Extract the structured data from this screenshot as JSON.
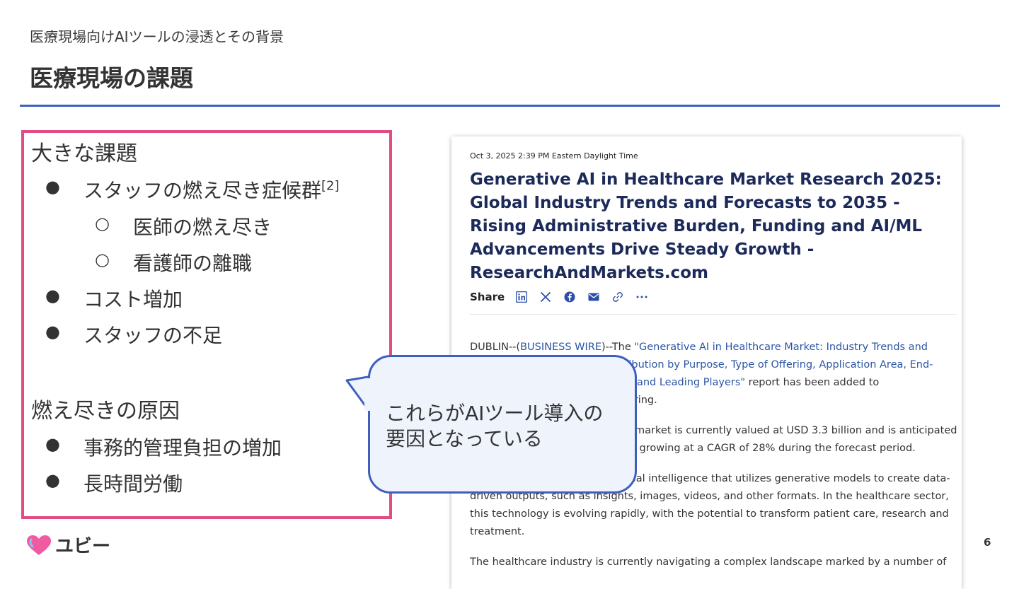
{
  "header": {
    "subtitle": "医療現場向けAIツールの浸透とその背景",
    "title": "医療現場の課題"
  },
  "left": {
    "section1_heading": "大きな課題",
    "bullets1": [
      {
        "label": "スタッフの燃え尽き症候群",
        "ref": "[2]"
      },
      {
        "label": "コスト増加"
      },
      {
        "label": "スタッフの不足"
      }
    ],
    "sub_bullets": [
      "医師の燃え尽き",
      "看護師の離職"
    ],
    "section2_heading": "燃え尽きの原因",
    "bullets2": [
      "事務的管理負担の増加",
      "長時間労働"
    ]
  },
  "article": {
    "date": "Oct 3, 2025 2:39 PM Eastern Daylight Time",
    "title": "Generative AI in Healthcare Market Research 2025: Global Industry Trends and Forecasts to 2035 - Rising Administrative Burden, Funding and AI/ML Advancements Drive Steady Growth - ResearchAndMarkets.com",
    "share_label": "Share",
    "share_icons": [
      "linkedin-icon",
      "x-icon",
      "facebook-icon",
      "email-icon",
      "link-icon",
      "more-icon"
    ],
    "p1_prefix": "DUBLIN--(",
    "p1_bw": "BUSINESS WIRE",
    "p1_mid": ")--The ",
    "p1_link": "\"Generative AI in Healthcare Market: Industry Trends and Global Forecasts to 2035: Distribution by Purpose, Type of Offering, Application Area, End-User, Key Geographical Regions and Leading Players\"",
    "p1_rest": " report has been added to ResearchAndMarkets.com's offering.",
    "p2": "The generative AI in healthcare market is currently valued at USD 3.3 billion and is anticipated to reach USD 39 billion by 2035, growing at a CAGR of 28% during the forecast period.",
    "p3": "Generative AI is a type of artificial intelligence that utilizes generative models to create data-driven outputs, such as insights, images, videos, and other formats. In the healthcare sector, this technology is evolving rapidly, with the potential to transform patient care, research and treatment.",
    "p4": "The healthcare industry is currently navigating a complex landscape marked by a number of"
  },
  "callout": {
    "line1": "これらがAIツール導入の",
    "line2": "要因となっている"
  },
  "footer": {
    "logo_text": "ユビー",
    "page_number": "6"
  },
  "colors": {
    "accent_blue": "#3f5fbf",
    "box_pink": "#e24c84",
    "article_title": "#1c2a5a",
    "link_blue": "#2b55a5"
  }
}
